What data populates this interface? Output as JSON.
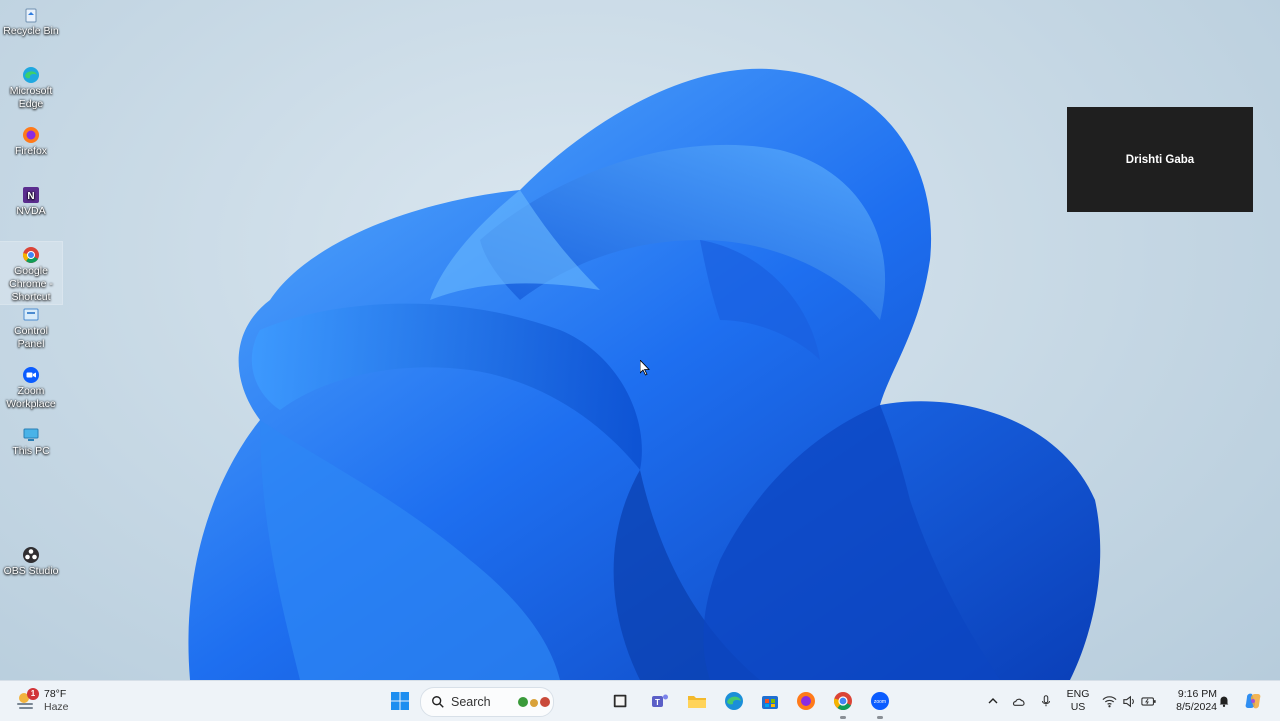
{
  "desktop": {
    "icons": [
      {
        "label": "Recycle Bin",
        "icon": "recycle-bin-icon"
      },
      {
        "label": "Microsoft\nEdge",
        "icon": "edge-icon"
      },
      {
        "label": "Firefox",
        "icon": "firefox-icon"
      },
      {
        "label": "NVDA",
        "icon": "nvda-icon"
      },
      {
        "label": "Google\nChrome -\nShortcut",
        "icon": "chrome-icon"
      },
      {
        "label": "Control Panel",
        "icon": "control-panel-icon"
      },
      {
        "label": "Zoom\nWorkplace",
        "icon": "zoom-icon"
      },
      {
        "label": "This PC",
        "icon": "this-pc-icon"
      },
      {
        "label": "OBS Studio",
        "icon": "obs-icon"
      }
    ]
  },
  "zoom_tile": {
    "name": "Drishti Gaba",
    "bg": "#1f1f1f"
  },
  "taskbar": {
    "weather": {
      "temp": "78°F",
      "condition": "Haze",
      "badge": "1"
    },
    "search_label": "Search",
    "apps": [
      "windows-start-icon",
      "search-icon",
      "widgets-icon",
      "task-view-icon",
      "teams-icon",
      "file-explorer-icon",
      "edge-icon",
      "store-icon",
      "firefox-icon",
      "chrome-icon",
      "zoom-icon"
    ],
    "tray": {
      "language_line1": "ENG",
      "language_line2": "US",
      "time": "9:16 PM",
      "date": "8/5/2024"
    }
  },
  "colors": {
    "accent": "#1a73e8",
    "taskbar": "#eef3f8"
  }
}
